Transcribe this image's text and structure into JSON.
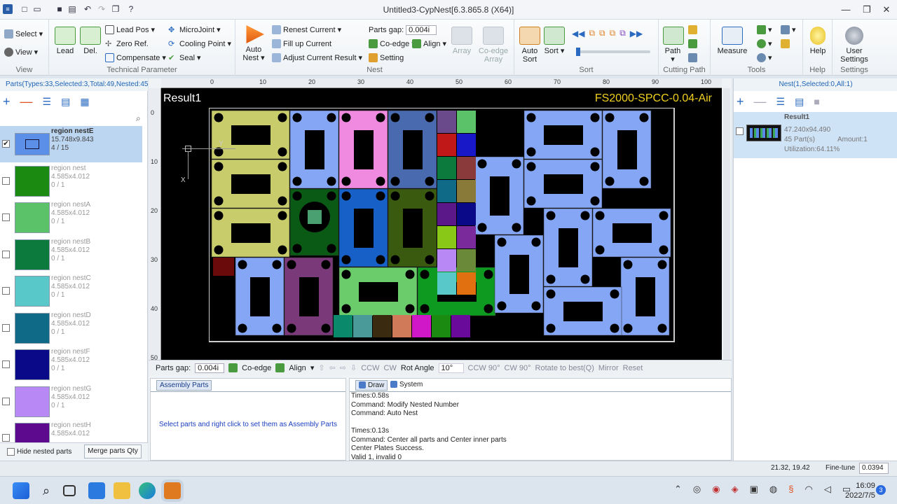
{
  "window": {
    "title": "Untitled3-CypNest[6.3.865.8 (X64)]"
  },
  "ribbon": {
    "view": {
      "label": "View",
      "select": "Select",
      "view": "View"
    },
    "tech": {
      "label": "Technical Parameter",
      "lead": "Lead",
      "del": "Del.",
      "lead_pos": "Lead Pos",
      "zero_ref": "Zero Ref.",
      "compensate": "Compensate",
      "microjoint": "MicroJoint",
      "cooling_point": "Cooling Point",
      "seal": "Seal"
    },
    "nest": {
      "label": "Nest",
      "auto_nest": "Auto Nest",
      "renest": "Renest Current",
      "fill_up": "Fill up Current",
      "adjust": "Adjust Current Result",
      "parts_gap_label": "Parts gap:",
      "parts_gap_value": "0.004i",
      "co_edge": "Co-edge",
      "align": "Align",
      "setting": "Setting",
      "array": "Array",
      "co_edge_array": "Co-edge Array"
    },
    "sort": {
      "label": "Sort",
      "auto_sort": "Auto Sort",
      "sort": "Sort"
    },
    "cutting": {
      "label": "Cutting Path",
      "path": "Path"
    },
    "tools": {
      "label": "Tools",
      "measure": "Measure"
    },
    "help": {
      "label": "Help",
      "help": "Help"
    },
    "settings": {
      "label": "Settings",
      "user_settings": "User Settings"
    }
  },
  "left": {
    "header": "Parts(Types:33,Selected:3,Total:49,Nested:45)",
    "parts": [
      {
        "name": "region nestE",
        "dims": "15.748x9.843",
        "count": "4 / 15",
        "color": "#5b8fe8",
        "checked": true
      },
      {
        "name": "region nest",
        "dims": "4.585x4.012",
        "count": "0 / 1",
        "color": "#1a8a10",
        "checked": false
      },
      {
        "name": "region nestA",
        "dims": "4.585x4.012",
        "count": "0 / 1",
        "color": "#5cc26a",
        "checked": false
      },
      {
        "name": "region nestB",
        "dims": "4.585x4.012",
        "count": "0 / 1",
        "color": "#0c7a3c",
        "checked": false
      },
      {
        "name": "region nestC",
        "dims": "4.585x4.012",
        "count": "0 / 1",
        "color": "#58c8c8",
        "checked": false
      },
      {
        "name": "region nestD",
        "dims": "4.585x4.012",
        "count": "0 / 1",
        "color": "#0e6a86",
        "checked": false
      },
      {
        "name": "region nestF",
        "dims": "4.585x4.012",
        "count": "0 / 1",
        "color": "#0a0a88",
        "checked": false
      },
      {
        "name": "region nestG",
        "dims": "4.585x4.012",
        "count": "0 / 1",
        "color": "#b888f4",
        "checked": false
      },
      {
        "name": "region nestH",
        "dims": "4.585x4.012",
        "count": "",
        "color": "#5e0a8e",
        "checked": false
      }
    ],
    "hide_nested": "Hide nested parts",
    "merge_btn": "Merge parts Qty"
  },
  "canvas": {
    "result_label": "Result1",
    "material": "FS2000-SPCC-0.04-Air",
    "ruler_top": [
      "0",
      "10",
      "20",
      "30",
      "40",
      "50",
      "60",
      "70",
      "80",
      "90",
      "100"
    ],
    "ruler_left": [
      "0",
      "10",
      "20",
      "30",
      "40",
      "50"
    ],
    "axis_x": "X",
    "axis_y": "Y"
  },
  "toolbar2": {
    "parts_gap_label": "Parts gap:",
    "parts_gap_value": "0.004i",
    "co_edge": "Co-edge",
    "align": "Align",
    "ccw": "CCW",
    "cw": "CW",
    "rot_angle": "Rot Angle",
    "rot_value": "10°",
    "ccw90": "CCW 90°",
    "cw90": "CW 90°",
    "rotate_best": "Rotate to best(Q)",
    "mirror": "Mirror",
    "reset": "Reset"
  },
  "bottom": {
    "assembly_tab": "Assembly Parts",
    "assembly_hint": "Select parts and right click to set them as Assembly Parts",
    "draw_tab": "Draw",
    "system_tab": "System",
    "log": [
      "Times:0.58s",
      "Command: Modify Nested Number",
      "Command: Auto Nest",
      "",
      "Times:0.13s",
      "Command: Center all parts and Center inner parts",
      "Center Plates Success.",
      "Valid 1, invalid 0"
    ]
  },
  "right": {
    "header": "Nest(1,Selected:0,All:1)",
    "result": {
      "name": "Result1",
      "size": "47.240x94.490",
      "parts": "45 Part(s)",
      "amount": "Amount:1",
      "utilization": "Utilization:64.11%"
    }
  },
  "status": {
    "coords": "21.32, 19.42",
    "finetune_label": "Fine-tune",
    "finetune_value": "0.0394"
  },
  "taskbar": {
    "time": "16:09",
    "date": "2022/7/5",
    "badge": "3"
  }
}
